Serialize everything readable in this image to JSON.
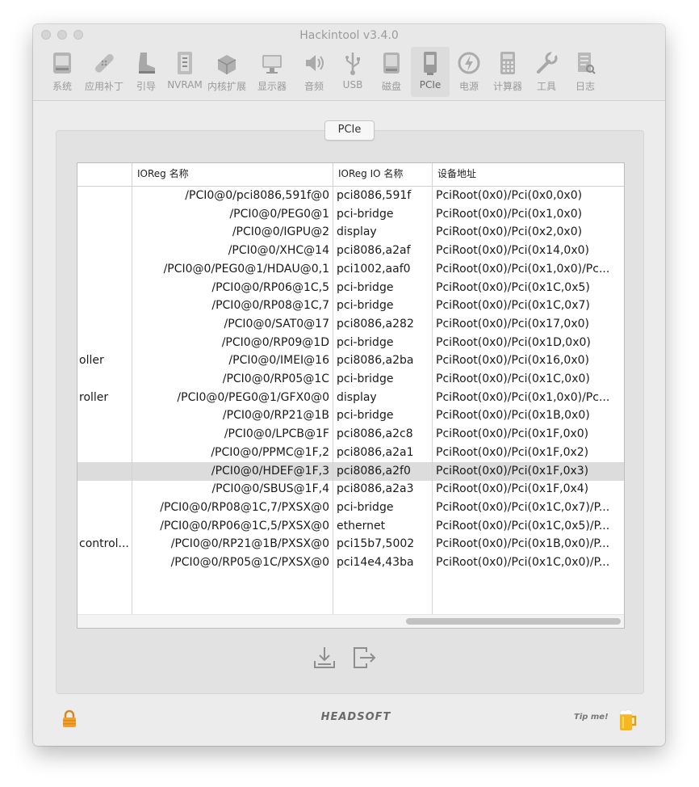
{
  "window": {
    "title": "Hackintool v3.4.0"
  },
  "toolbar": {
    "items": [
      {
        "label": "系统",
        "icon": "system-icon"
      },
      {
        "label": "应用补丁",
        "icon": "patch-icon"
      },
      {
        "label": "引导",
        "icon": "boot-icon"
      },
      {
        "label": "NVRAM",
        "icon": "nvram-icon"
      },
      {
        "label": "内核扩展",
        "icon": "kext-icon"
      },
      {
        "label": "显示器",
        "icon": "display-icon"
      },
      {
        "label": "音频",
        "icon": "audio-icon"
      },
      {
        "label": "USB",
        "icon": "usb-icon"
      },
      {
        "label": "磁盘",
        "icon": "disk-icon"
      },
      {
        "label": "PCIe",
        "icon": "pcie-icon",
        "active": true
      },
      {
        "label": "电源",
        "icon": "power-icon"
      },
      {
        "label": "计算器",
        "icon": "calculator-icon"
      },
      {
        "label": "工具",
        "icon": "tools-icon"
      },
      {
        "label": "日志",
        "icon": "log-icon"
      }
    ]
  },
  "tab": {
    "label": "PCIe"
  },
  "table": {
    "columns": [
      "",
      "IOReg 名称",
      "IOReg IO 名称",
      "设备地址"
    ],
    "rows": [
      [
        "",
        "/PCI0@0/pci8086,591f@0",
        "pci8086,591f",
        "PciRoot(0x0)/Pci(0x0,0x0)"
      ],
      [
        "",
        "/PCI0@0/PEG0@1",
        "pci-bridge",
        "PciRoot(0x0)/Pci(0x1,0x0)"
      ],
      [
        "",
        "/PCI0@0/IGPU@2",
        "display",
        "PciRoot(0x0)/Pci(0x2,0x0)"
      ],
      [
        "",
        "/PCI0@0/XHC@14",
        "pci8086,a2af",
        "PciRoot(0x0)/Pci(0x14,0x0)"
      ],
      [
        "",
        "/PCI0@0/PEG0@1/HDAU@0,1",
        "pci1002,aaf0",
        "PciRoot(0x0)/Pci(0x1,0x0)/Pc..."
      ],
      [
        "",
        "/PCI0@0/RP06@1C,5",
        "pci-bridge",
        "PciRoot(0x0)/Pci(0x1C,0x5)"
      ],
      [
        "",
        "/PCI0@0/RP08@1C,7",
        "pci-bridge",
        "PciRoot(0x0)/Pci(0x1C,0x7)"
      ],
      [
        "",
        "/PCI0@0/SAT0@17",
        "pci8086,a282",
        "PciRoot(0x0)/Pci(0x17,0x0)"
      ],
      [
        "",
        "/PCI0@0/RP09@1D",
        "pci-bridge",
        "PciRoot(0x0)/Pci(0x1D,0x0)"
      ],
      [
        "oller",
        "/PCI0@0/IMEI@16",
        "pci8086,a2ba",
        "PciRoot(0x0)/Pci(0x16,0x0)"
      ],
      [
        "",
        "/PCI0@0/RP05@1C",
        "pci-bridge",
        "PciRoot(0x0)/Pci(0x1C,0x0)"
      ],
      [
        "roller",
        "/PCI0@0/PEG0@1/GFX0@0",
        "display",
        "PciRoot(0x0)/Pci(0x1,0x0)/Pc..."
      ],
      [
        "",
        "/PCI0@0/RP21@1B",
        "pci-bridge",
        "PciRoot(0x0)/Pci(0x1B,0x0)"
      ],
      [
        "",
        "/PCI0@0/LPCB@1F",
        "pci8086,a2c8",
        "PciRoot(0x0)/Pci(0x1F,0x0)"
      ],
      [
        "",
        "/PCI0@0/PPMC@1F,2",
        "pci8086,a2a1",
        "PciRoot(0x0)/Pci(0x1F,0x2)"
      ],
      [
        "",
        "/PCI0@0/HDEF@1F,3",
        "pci8086,a2f0",
        "PciRoot(0x0)/Pci(0x1F,0x3)"
      ],
      [
        "",
        "/PCI0@0/SBUS@1F,4",
        "pci8086,a2a3",
        "PciRoot(0x0)/Pci(0x1F,0x4)"
      ],
      [
        "",
        "/PCI0@0/RP08@1C,7/PXSX@0",
        "pci-bridge",
        "PciRoot(0x0)/Pci(0x1C,0x7)/P..."
      ],
      [
        "",
        "/PCI0@0/RP06@1C,5/PXSX@0",
        "ethernet",
        "PciRoot(0x0)/Pci(0x1C,0x5)/P..."
      ],
      [
        "control...",
        "/PCI0@0/RP21@1B/PXSX@0",
        "pci15b7,5002",
        "PciRoot(0x0)/Pci(0x1B,0x0)/P..."
      ],
      [
        "",
        "/PCI0@0/RP05@1C/PXSX@0",
        "pci14e4,43ba",
        "PciRoot(0x0)/Pci(0x1C,0x0)/P..."
      ]
    ],
    "selected_row": 15
  },
  "footer": {
    "brand": "HEADSOFT",
    "tip": "Tip me!"
  },
  "colors": {
    "window_bg": "#ececec",
    "panel_bg": "#e2e2e2",
    "selected_row": "#dcdcdc",
    "icon_gray": "#a8a8a8",
    "lock_orange": "#f0a030",
    "beer_yellow": "#f5b820"
  }
}
